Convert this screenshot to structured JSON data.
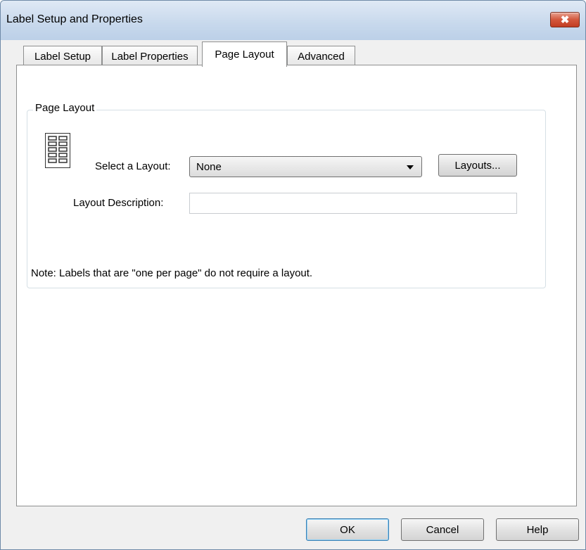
{
  "window": {
    "title": "Label Setup and Properties",
    "close_glyph": "✖"
  },
  "tabs": [
    {
      "label": "Label Setup"
    },
    {
      "label": "Label Properties"
    },
    {
      "label": "Page Layout"
    },
    {
      "label": "Advanced"
    }
  ],
  "active_tab": "Page Layout",
  "page_layout": {
    "group_title": "Page Layout",
    "icon": "page-layout-grid-icon",
    "select_label": "Select a Layout:",
    "select_value": "None",
    "layouts_button": "Layouts...",
    "description_label": "Layout Description:",
    "description_value": "",
    "note": "Note: Labels that are \"one per page\" do not require a layout."
  },
  "footer": {
    "ok": "OK",
    "cancel": "Cancel",
    "help": "Help"
  }
}
